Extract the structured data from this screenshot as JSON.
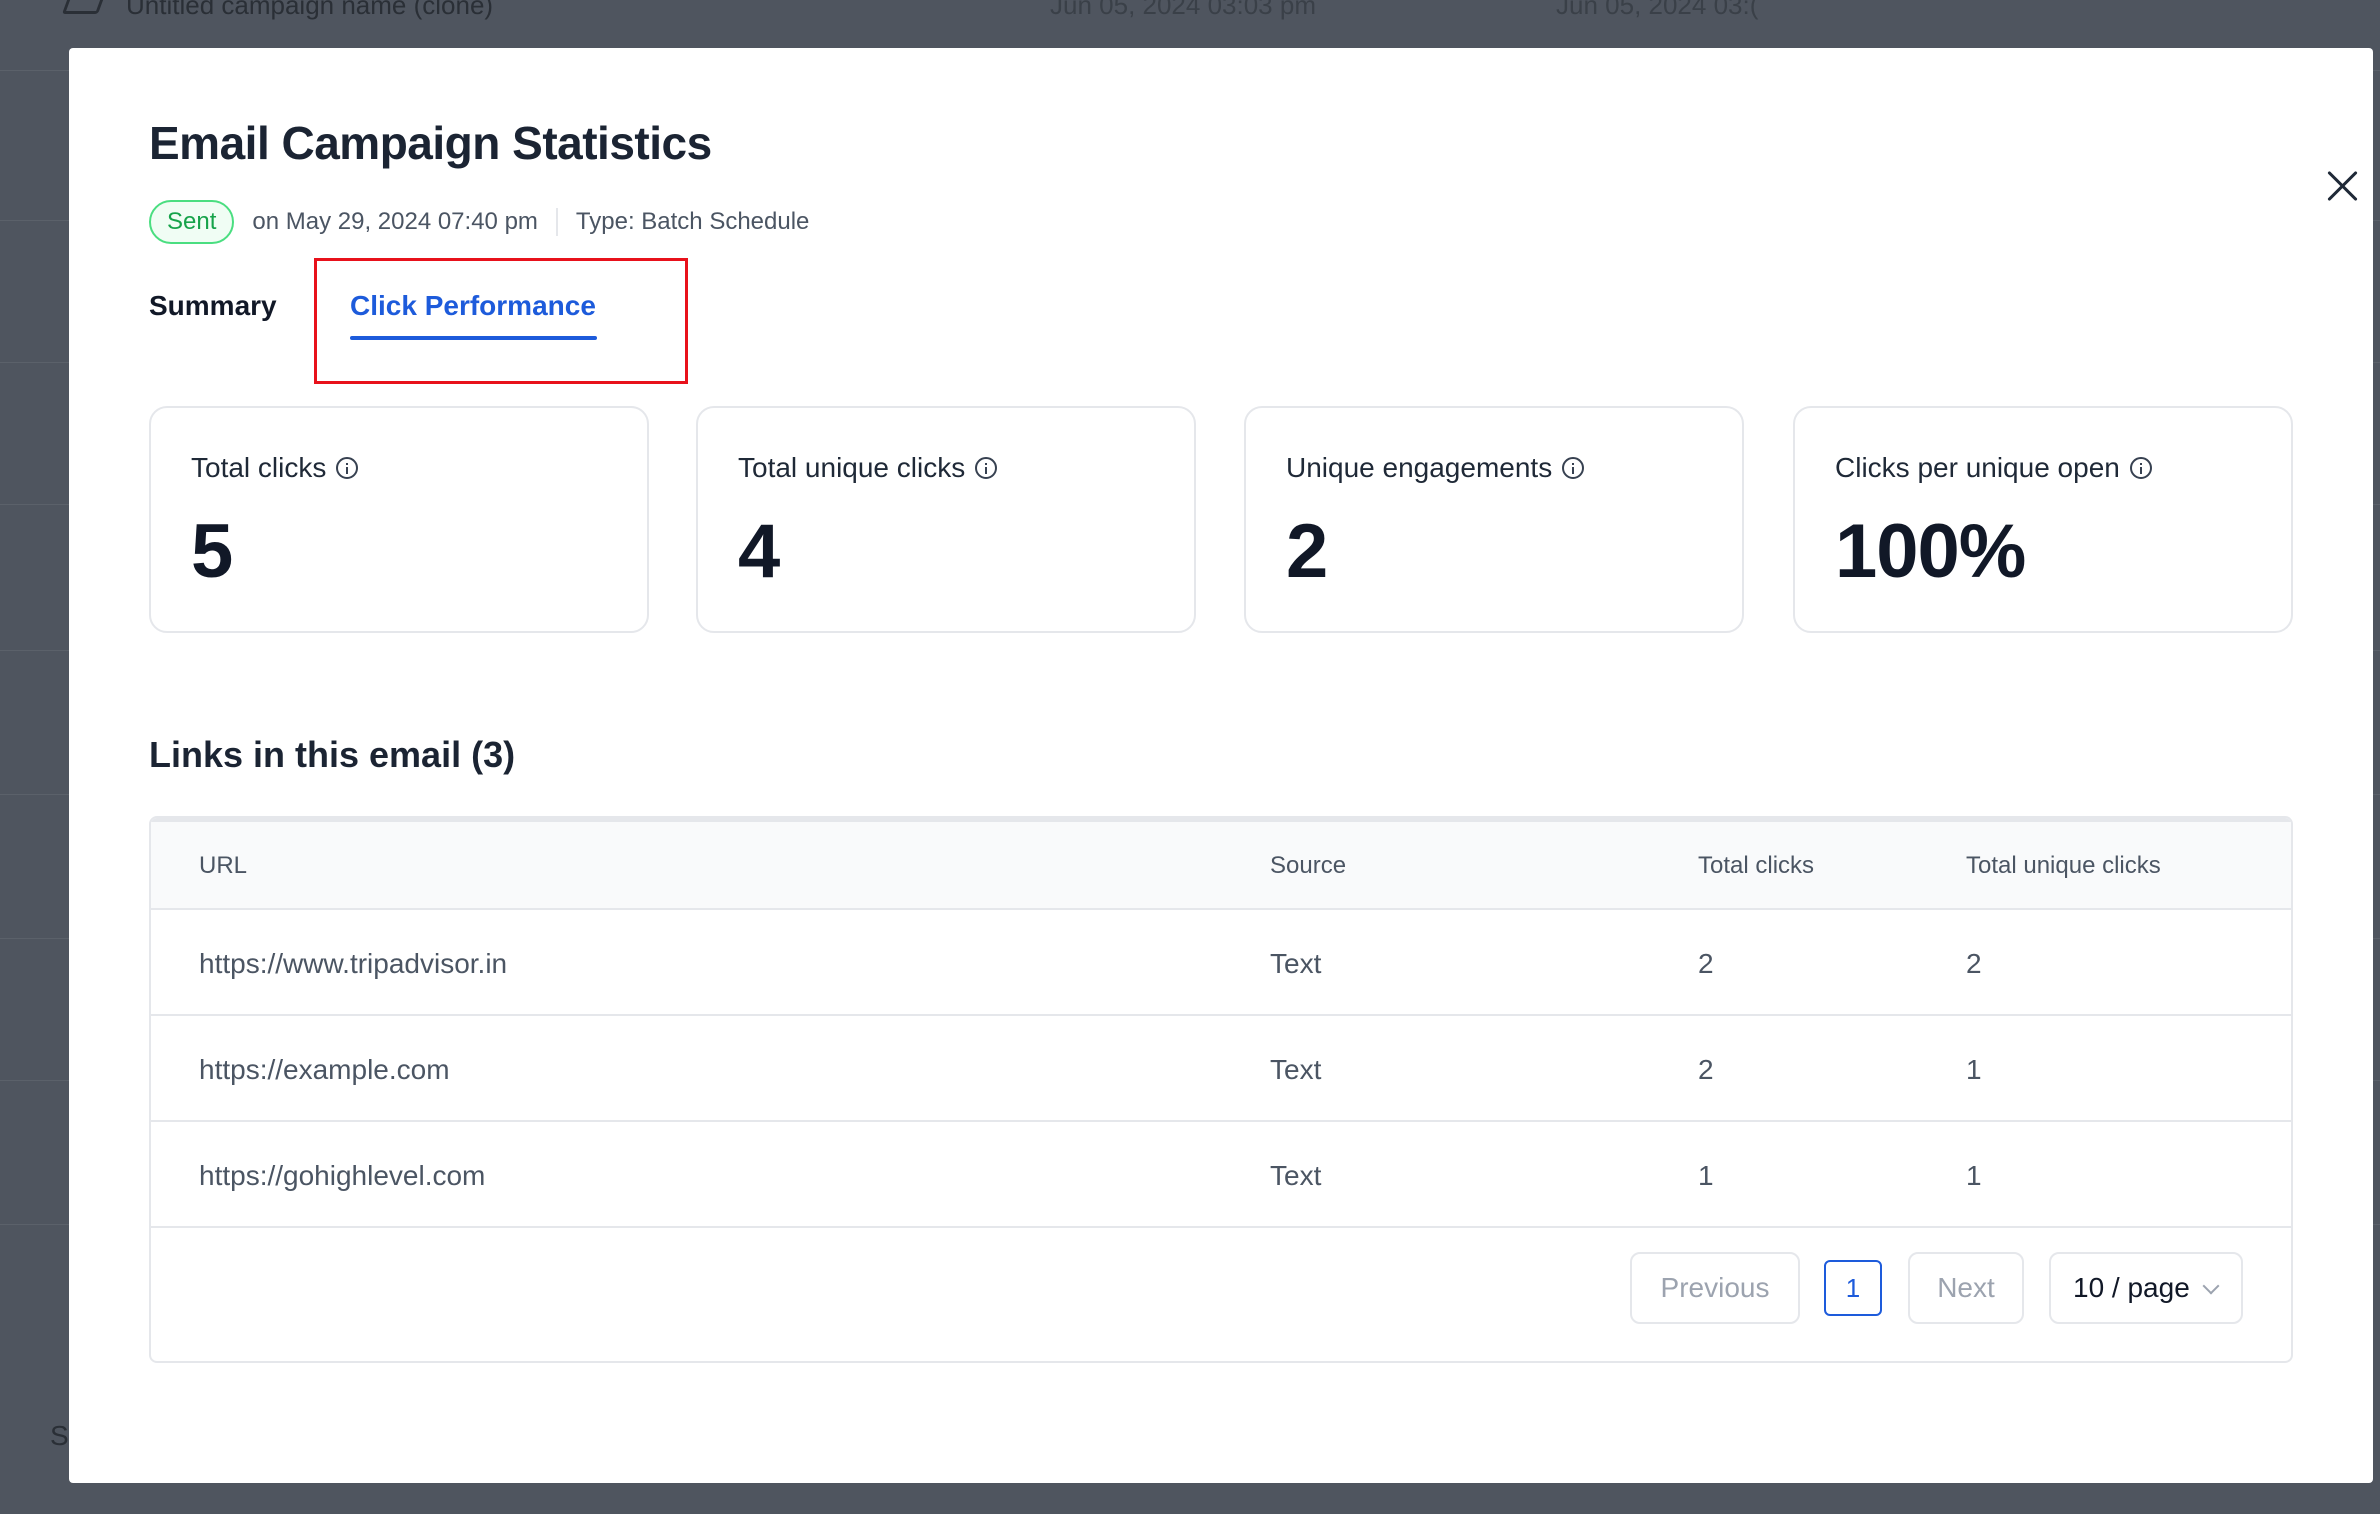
{
  "background": {
    "top_row": {
      "name": "Untitled campaign name (clone)",
      "date1": "Jun 05, 2024 03:03 pm",
      "date2": "Jun 05, 2024 03:("
    },
    "footer_text": "S"
  },
  "modal": {
    "title": "Email Campaign Statistics",
    "status_badge": "Sent",
    "sent_on": "on May 29, 2024 07:40 pm",
    "type": "Type: Batch Schedule",
    "tabs": [
      {
        "label": "Summary",
        "active": false
      },
      {
        "label": "Click Performance",
        "active": true
      }
    ],
    "stats": [
      {
        "label": "Total clicks",
        "value": "5"
      },
      {
        "label": "Total unique clicks",
        "value": "4"
      },
      {
        "label": "Unique engagements",
        "value": "2"
      },
      {
        "label": "Clicks per unique open",
        "value": "100%"
      }
    ],
    "links_title": "Links in this email (3)",
    "table": {
      "headers": [
        "URL",
        "Source",
        "Total clicks",
        "Total unique clicks"
      ],
      "rows": [
        {
          "url": "https://www.tripadvisor.in",
          "source": "Text",
          "total_clicks": "2",
          "unique_clicks": "2"
        },
        {
          "url": "https://example.com",
          "source": "Text",
          "total_clicks": "2",
          "unique_clicks": "1"
        },
        {
          "url": "https://gohighlevel.com",
          "source": "Text",
          "total_clicks": "1",
          "unique_clicks": "1"
        }
      ]
    },
    "pagination": {
      "previous": "Previous",
      "current_page": "1",
      "next": "Next",
      "page_size": "10 / page"
    }
  },
  "colors": {
    "accent": "#1d5bdb",
    "badge_green": "#16a34a",
    "highlight_red": "#e8111b"
  }
}
